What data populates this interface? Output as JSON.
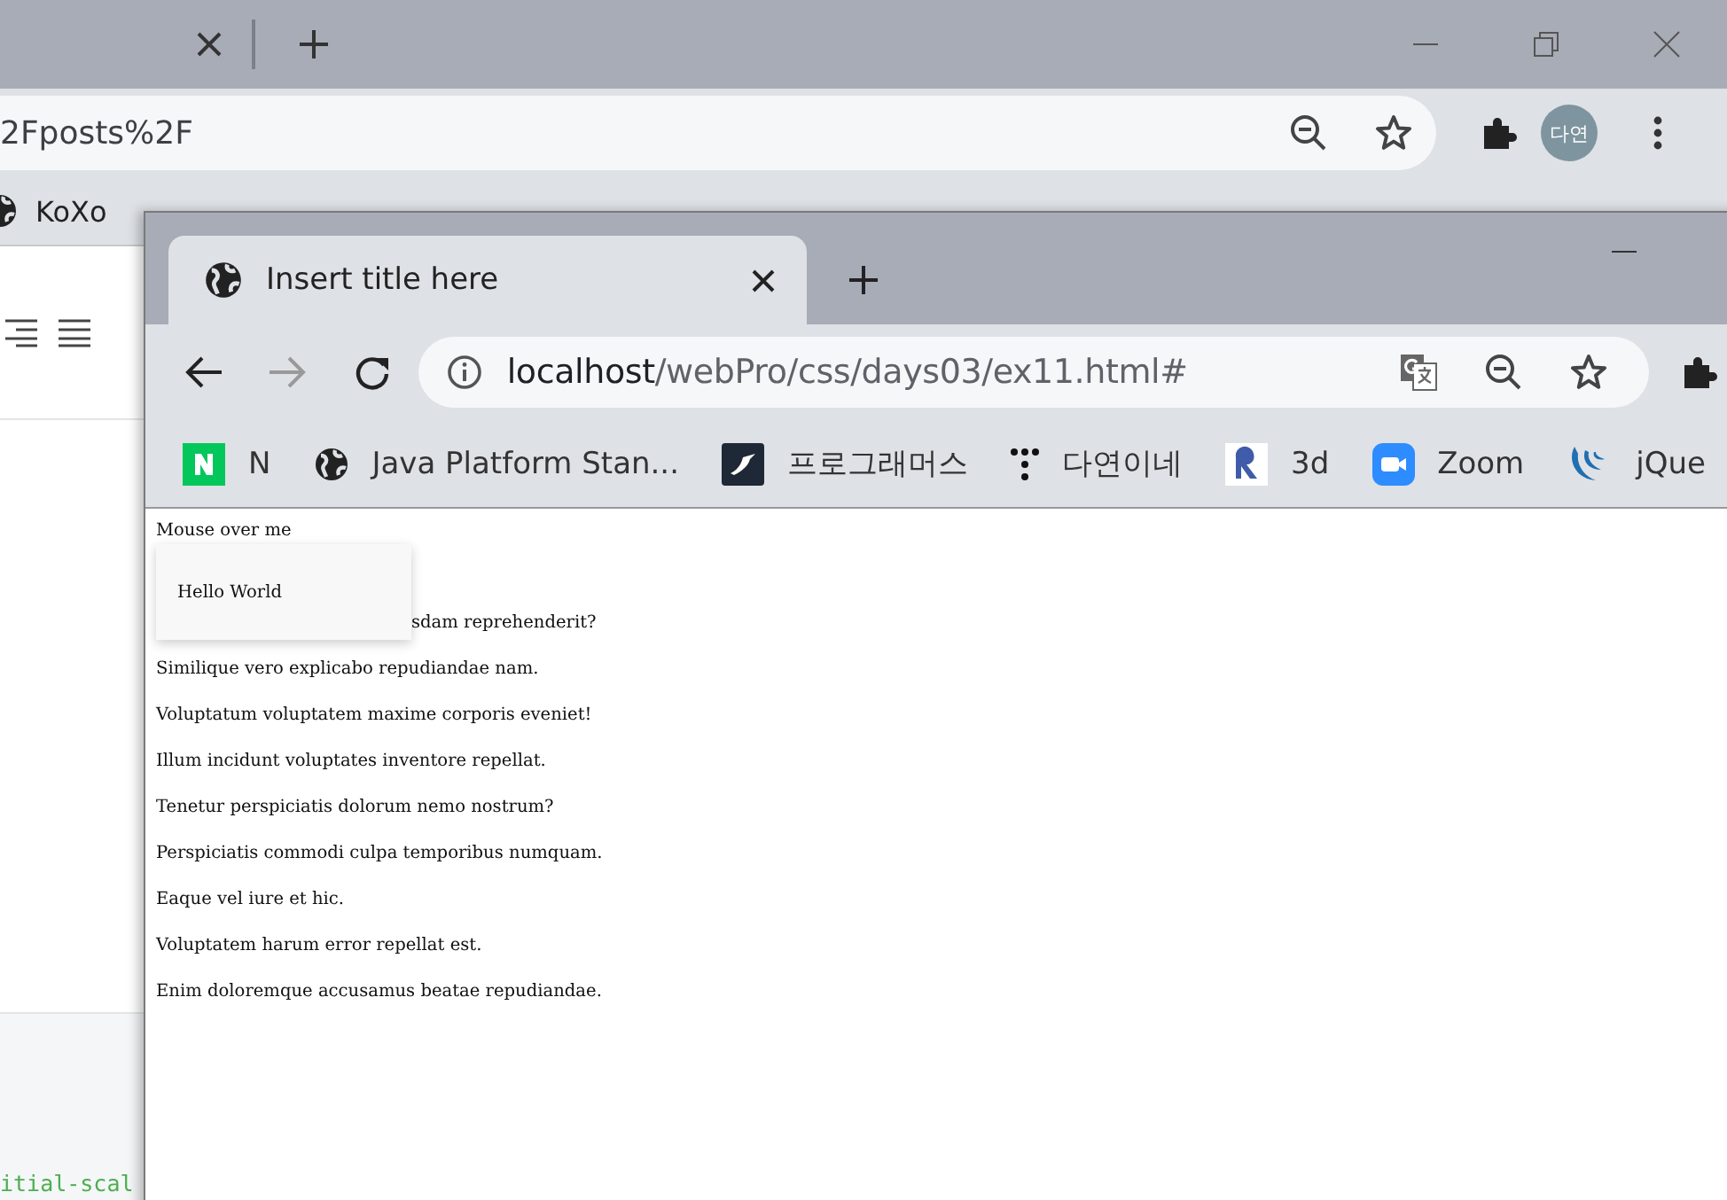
{
  "back_window": {
    "address": "2Fposts%2F",
    "profile": "다연",
    "bookmarks": [
      {
        "label": "KoXo",
        "kind": "globe"
      }
    ],
    "code_text": "itial-scal"
  },
  "front_window": {
    "tab": {
      "title": "Insert title here",
      "selected": true
    },
    "address": {
      "host": "localhost",
      "path": "/webPro/css/days03/ex11.html#"
    },
    "bookmarks": [
      {
        "label": "N",
        "kind": "naver"
      },
      {
        "label": "Java Platform Stan...",
        "kind": "globe"
      },
      {
        "label": "프로그래머스",
        "kind": "programmers"
      },
      {
        "label": "다연이네",
        "kind": "dots"
      },
      {
        "label": "3d",
        "kind": "r-logo"
      },
      {
        "label": "Zoom",
        "kind": "zoom"
      },
      {
        "label": "jQue",
        "kind": "jquery"
      }
    ],
    "page": {
      "lines": [
        {
          "text": "Mouse over me",
          "kind": "line"
        },
        {
          "text": "sdam reprehenderit?",
          "kind": "beside-tooltip"
        },
        {
          "text": "Similique vero explicabo repudiandae nam.",
          "kind": "line"
        },
        {
          "text": "Voluptatum voluptatem maxime corporis eveniet!",
          "kind": "line"
        },
        {
          "text": "Illum incidunt voluptates inventore repellat.",
          "kind": "line"
        },
        {
          "text": "Tenetur perspiciatis dolorum nemo nostrum?",
          "kind": "line"
        },
        {
          "text": "Perspiciatis commodi culpa temporibus numquam.",
          "kind": "line"
        },
        {
          "text": "Eaque vel iure et hic.",
          "kind": "line"
        },
        {
          "text": "Voluptatem harum error repellat est.",
          "kind": "line"
        },
        {
          "text": "Enim doloremque accusamus beatae repudiandae.",
          "kind": "line"
        }
      ],
      "tooltip": "Hello World"
    }
  }
}
